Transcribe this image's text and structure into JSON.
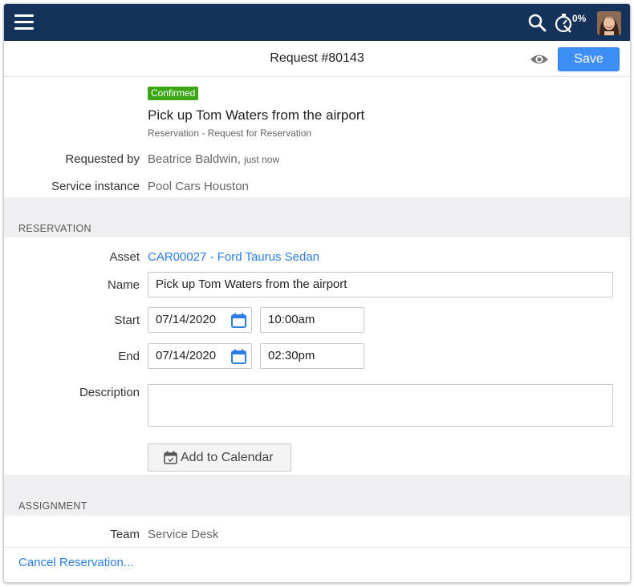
{
  "topbar": {
    "timer_percent": "0%",
    "icons": [
      "menu-icon",
      "search-icon",
      "timer-icon",
      "avatar"
    ],
    "background_color": "#15335a"
  },
  "header": {
    "title": "Request #80143",
    "save_label": "Save"
  },
  "request": {
    "status": "Confirmed",
    "status_color": "#3aa613",
    "subject": "Pick up Tom Waters from the airport",
    "category": "Reservation - Request for Reservation",
    "requested_by_label": "Requested by",
    "requested_by_value": "Beatrice Baldwin,",
    "requested_by_time": "just now",
    "service_instance_label": "Service instance",
    "service_instance_value": "Pool Cars Houston"
  },
  "reservation": {
    "section_title": "RESERVATION",
    "asset_label": "Asset",
    "asset_value": "CAR00027 - Ford Taurus Sedan",
    "name_label": "Name",
    "name_value": "Pick up Tom Waters from the airport",
    "start_label": "Start",
    "start_date": "07/14/2020",
    "start_time": "10:00am",
    "end_label": "End",
    "end_date": "07/14/2020",
    "end_time": "02:30pm",
    "description_label": "Description",
    "description_value": "",
    "add_to_calendar_label": "Add to Calendar"
  },
  "assignment": {
    "section_title": "ASSIGNMENT",
    "team_label": "Team",
    "team_value": "Service Desk"
  },
  "footer": {
    "cancel_link": "Cancel Reservation..."
  },
  "colors": {
    "accent": "#3d8ef5",
    "link": "#2a7de1"
  }
}
